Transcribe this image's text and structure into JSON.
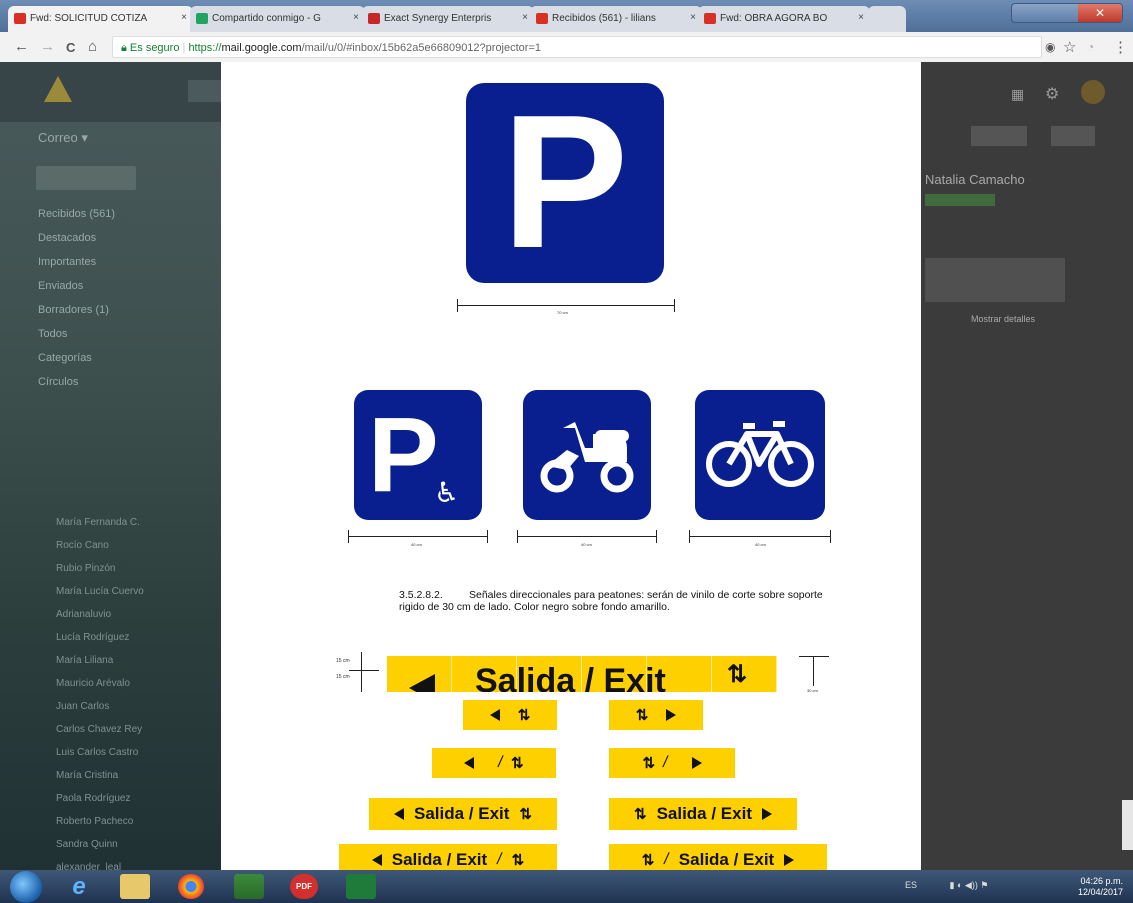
{
  "browser": {
    "tabs": [
      {
        "label": "Fwd: SOLICITUD COTIZA",
        "color": "#d93025"
      },
      {
        "label": "Compartido conmigo - G",
        "color": "#1fa463"
      },
      {
        "label": "Exact Synergy Enterpris",
        "color": "#c62828"
      },
      {
        "label": "Recibidos (561) - lilians",
        "color": "#d93025"
      },
      {
        "label": "Fwd: OBRA AGORA BO",
        "color": "#d93025"
      }
    ],
    "close_glyph": "×",
    "nav": {
      "back": "←",
      "forward": "→",
      "reload": "C",
      "home": "⌂"
    },
    "url": {
      "secure_label": "Es seguro",
      "scheme": "https://",
      "host": "mail.google.com",
      "path": "/mail/u/0/#inbox/15b62a5e66809012?projector=1"
    },
    "actions": {
      "star": "☆",
      "menu": "⋮"
    }
  },
  "gmail_background": {
    "mail_label": "Correo ▾",
    "sidebar": [
      "Recibidos (561)",
      "Destacados",
      "Importantes",
      "Enviados",
      "Borradores (1)",
      "Todos",
      "Categorías",
      "Círculos"
    ],
    "contacts": [
      "María Fernanda C.",
      "Rocío Cano",
      "Rubio Pinzón",
      "María Lucía Cuervo",
      "Adrianaluvio",
      "Lucía Rodríguez",
      "María Liliana",
      "Mauricio Arévalo",
      "Juan Carlos",
      "Carlos Chavez Rey",
      "Luis Carlos Castro",
      "María Cristina",
      "Paola Rodríguez",
      "Roberto Pacheco",
      "Sandra Quinn",
      "alexander_leal"
    ],
    "right_name": "Natalia Camacho",
    "right_link": "Mostrar detalles"
  },
  "document": {
    "big_sign": {
      "letter": "P",
      "dimension": "70 cm"
    },
    "small_signs": [
      {
        "name": "accessible-parking",
        "dimension": "40 cm"
      },
      {
        "name": "motorcycle-parking",
        "dimension": "40 cm"
      },
      {
        "name": "bicycle-parking",
        "dimension": "40 cm"
      }
    ],
    "paragraph": {
      "number": "3.5.2.8.2.",
      "text": "Señales direccionales para peatones: serán de vinilo de corte sobre soporte rigido de 30 cm de lado. Color negro sobre fondo amarillo."
    },
    "header_sign": {
      "text": "Salida / Exit",
      "dim_top": "15 cm",
      "dim_bottom": "15 cm",
      "dim_right": "30 cm"
    },
    "directional_signs": {
      "label": "Salida / Exit",
      "slash": "/",
      "pedestrian_glyph": "⇅"
    },
    "colors": {
      "sign_blue": "#0a1f8f",
      "sign_yellow": "#ffd000"
    }
  },
  "taskbar": {
    "pdf_label": "PDF",
    "time": "04:26 p.m.",
    "date": "12/04/2017",
    "tray_lang": "ES"
  }
}
